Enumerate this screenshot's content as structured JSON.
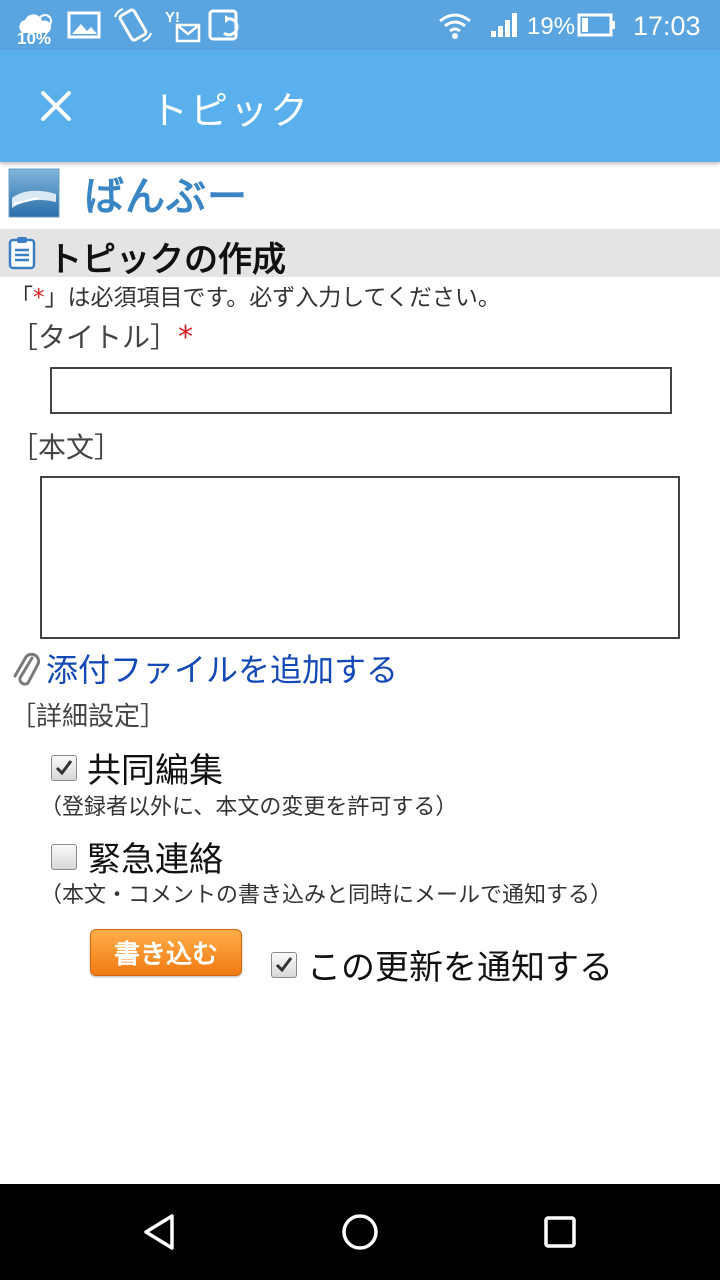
{
  "status": {
    "weather_percent": "10%",
    "battery": "19%",
    "time": "17:03",
    "icons": [
      "weather-cloud-icon",
      "image-icon",
      "rotate-icon",
      "yahoo-mail-icon",
      "sync-icon",
      "wifi-icon",
      "signal-icon",
      "battery-icon"
    ]
  },
  "appbar": {
    "title": "トピック",
    "close_icon": "close-icon"
  },
  "brand": {
    "name": "ばんぶー"
  },
  "section": {
    "title": "トピックの作成"
  },
  "form": {
    "required_note_open": "「",
    "required_mark": "*",
    "required_note_rest": "」は必須項目です。必ず入力してください。",
    "title_label": "［タイトル］",
    "title_required_mark": "*",
    "title_value": "",
    "body_label": "［本文］",
    "body_value": "",
    "attach_label": "添付ファイルを追加する",
    "advanced_label": "［詳細設定］",
    "collab_label": "共同編集",
    "collab_checked": true,
    "collab_hint": "（登録者以外に、本文の変更を許可する）",
    "urgent_label": "緊急連絡",
    "urgent_checked": false,
    "urgent_hint": "（本文・コメントの書き込みと同時にメールで通知する）",
    "submit_label": "書き込む",
    "notify_label": "この更新を通知する",
    "notify_checked": true
  },
  "colors": {
    "statusbar": "#5aa5e0",
    "appbar": "#5ab0ec",
    "brand_text": "#3a86c4",
    "link": "#1449b8",
    "required": "#dd2222",
    "button": "#f07a12"
  }
}
